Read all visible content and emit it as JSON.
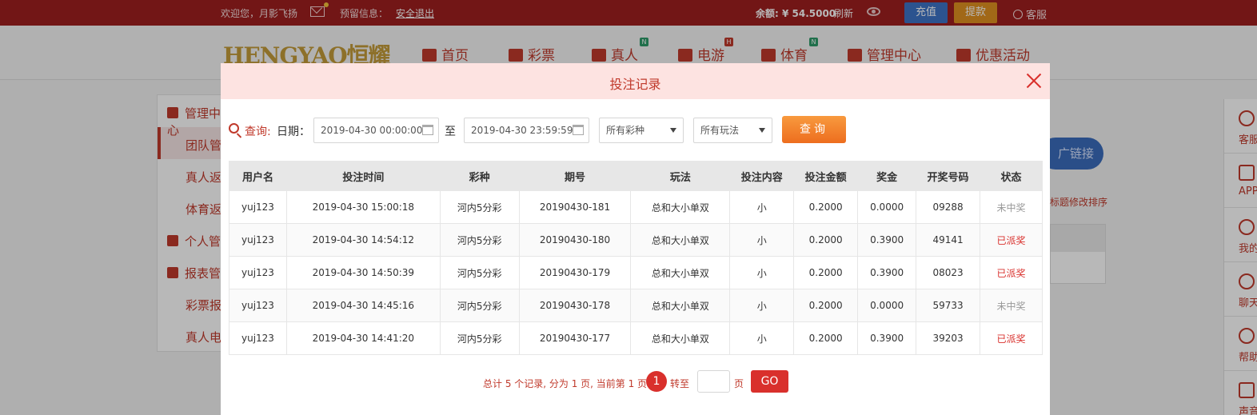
{
  "topbar": {
    "welcome": "欢迎您，月影飞扬",
    "notice_label": "预留信息：",
    "logout": "安全退出",
    "balance_label": "余额: ¥ 54.5000",
    "refresh": "刷新",
    "recharge": "充值",
    "withdraw": "提款",
    "service": "客服"
  },
  "nav": {
    "logo": "HENGYAO恒耀",
    "items": [
      {
        "label": "首页"
      },
      {
        "label": "彩票"
      },
      {
        "label": "真人",
        "badge": "N"
      },
      {
        "label": "电游",
        "badge": "H"
      },
      {
        "label": "体育",
        "badge": "N"
      },
      {
        "label": "管理中心"
      },
      {
        "label": "优惠活动"
      }
    ]
  },
  "sidebar": {
    "items": [
      "管理中心",
      "团队管",
      "真人返",
      "体育返",
      "个人管",
      "报表管",
      "彩票报",
      "真人电"
    ]
  },
  "right_bg": {
    "promo_link": "广链接",
    "sort_hint": "标题修改排序",
    "float_items": [
      "客服",
      "APP",
      "我的",
      "聊天",
      "帮助",
      "声音"
    ]
  },
  "modal": {
    "title": "投注记录",
    "query": {
      "label": "查询:",
      "date_label": "日期：",
      "start": "2019-04-30 00:00:00",
      "to_label": "至",
      "end": "2019-04-30 23:59:59",
      "lottery_select": "所有彩种",
      "play_select": "所有玩法",
      "button": "查询"
    },
    "table": {
      "headers": [
        "用户名",
        "投注时间",
        "彩种",
        "期号",
        "玩法",
        "投注内容",
        "投注金额",
        "奖金",
        "开奖号码",
        "状态"
      ],
      "rows": [
        [
          "yuj123",
          "2019-04-30 15:00:18",
          "河内5分彩",
          "20190430-181",
          "总和大小单双",
          "小",
          "0.2000",
          "0.0000",
          "09288",
          "未中奖"
        ],
        [
          "yuj123",
          "2019-04-30 14:54:12",
          "河内5分彩",
          "20190430-180",
          "总和大小单双",
          "小",
          "0.2000",
          "0.3900",
          "49141",
          "已派奖"
        ],
        [
          "yuj123",
          "2019-04-30 14:50:39",
          "河内5分彩",
          "20190430-179",
          "总和大小单双",
          "小",
          "0.2000",
          "0.3900",
          "08023",
          "已派奖"
        ],
        [
          "yuj123",
          "2019-04-30 14:45:16",
          "河内5分彩",
          "20190430-178",
          "总和大小单双",
          "小",
          "0.2000",
          "0.0000",
          "59733",
          "未中奖"
        ],
        [
          "yuj123",
          "2019-04-30 14:41:20",
          "河内5分彩",
          "20190430-177",
          "总和大小单双",
          "小",
          "0.2000",
          "0.3900",
          "39203",
          "已派奖"
        ]
      ]
    },
    "pager": {
      "summary": "总计 5 个记录, 分为 1 页, 当前第 1 页",
      "current_page": "1",
      "goto_label": "转至",
      "unit": "页",
      "go": "GO"
    }
  },
  "colors": {
    "brand_red": "#c0392b",
    "header_pink": "#fde3e1",
    "query_orange": "#ed6d1e",
    "win_red": "#d9302c",
    "lose_gray": "#999999"
  }
}
